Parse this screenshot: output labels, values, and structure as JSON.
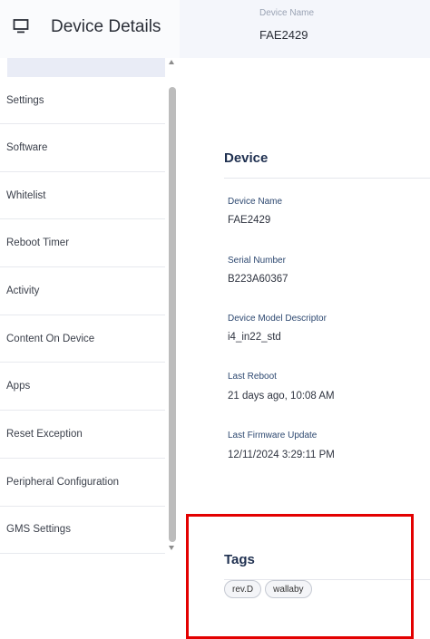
{
  "header": {
    "title": "Device Details",
    "device_name_label": "Device Name",
    "device_name_value": "FAE2429"
  },
  "sidebar": {
    "items": [
      {
        "label": "Settings"
      },
      {
        "label": "Software"
      },
      {
        "label": "Whitelist"
      },
      {
        "label": "Reboot Timer"
      },
      {
        "label": "Activity"
      },
      {
        "label": "Content On Device"
      },
      {
        "label": "Apps"
      },
      {
        "label": "Reset Exception"
      },
      {
        "label": "Peripheral Configuration"
      },
      {
        "label": "GMS Settings"
      }
    ]
  },
  "device": {
    "title": "Device",
    "fields": [
      {
        "label": "Device Name",
        "value": "FAE2429"
      },
      {
        "label": "Serial Number",
        "value": "B223A60367"
      },
      {
        "label": "Device Model Descriptor",
        "value": "i4_in22_std"
      },
      {
        "label": "Last Reboot",
        "value": "21 days ago, 10:08 AM"
      },
      {
        "label": "Last Firmware Update",
        "value": "12/11/2024 3:29:11 PM"
      }
    ]
  },
  "tags": {
    "title": "Tags",
    "items": [
      "rev.D",
      "wallaby"
    ]
  },
  "colors": {
    "highlight": "#e30000",
    "section_title": "#1f3050",
    "field_label": "#2d4870"
  },
  "icons": {
    "app": "monitor-icon"
  }
}
